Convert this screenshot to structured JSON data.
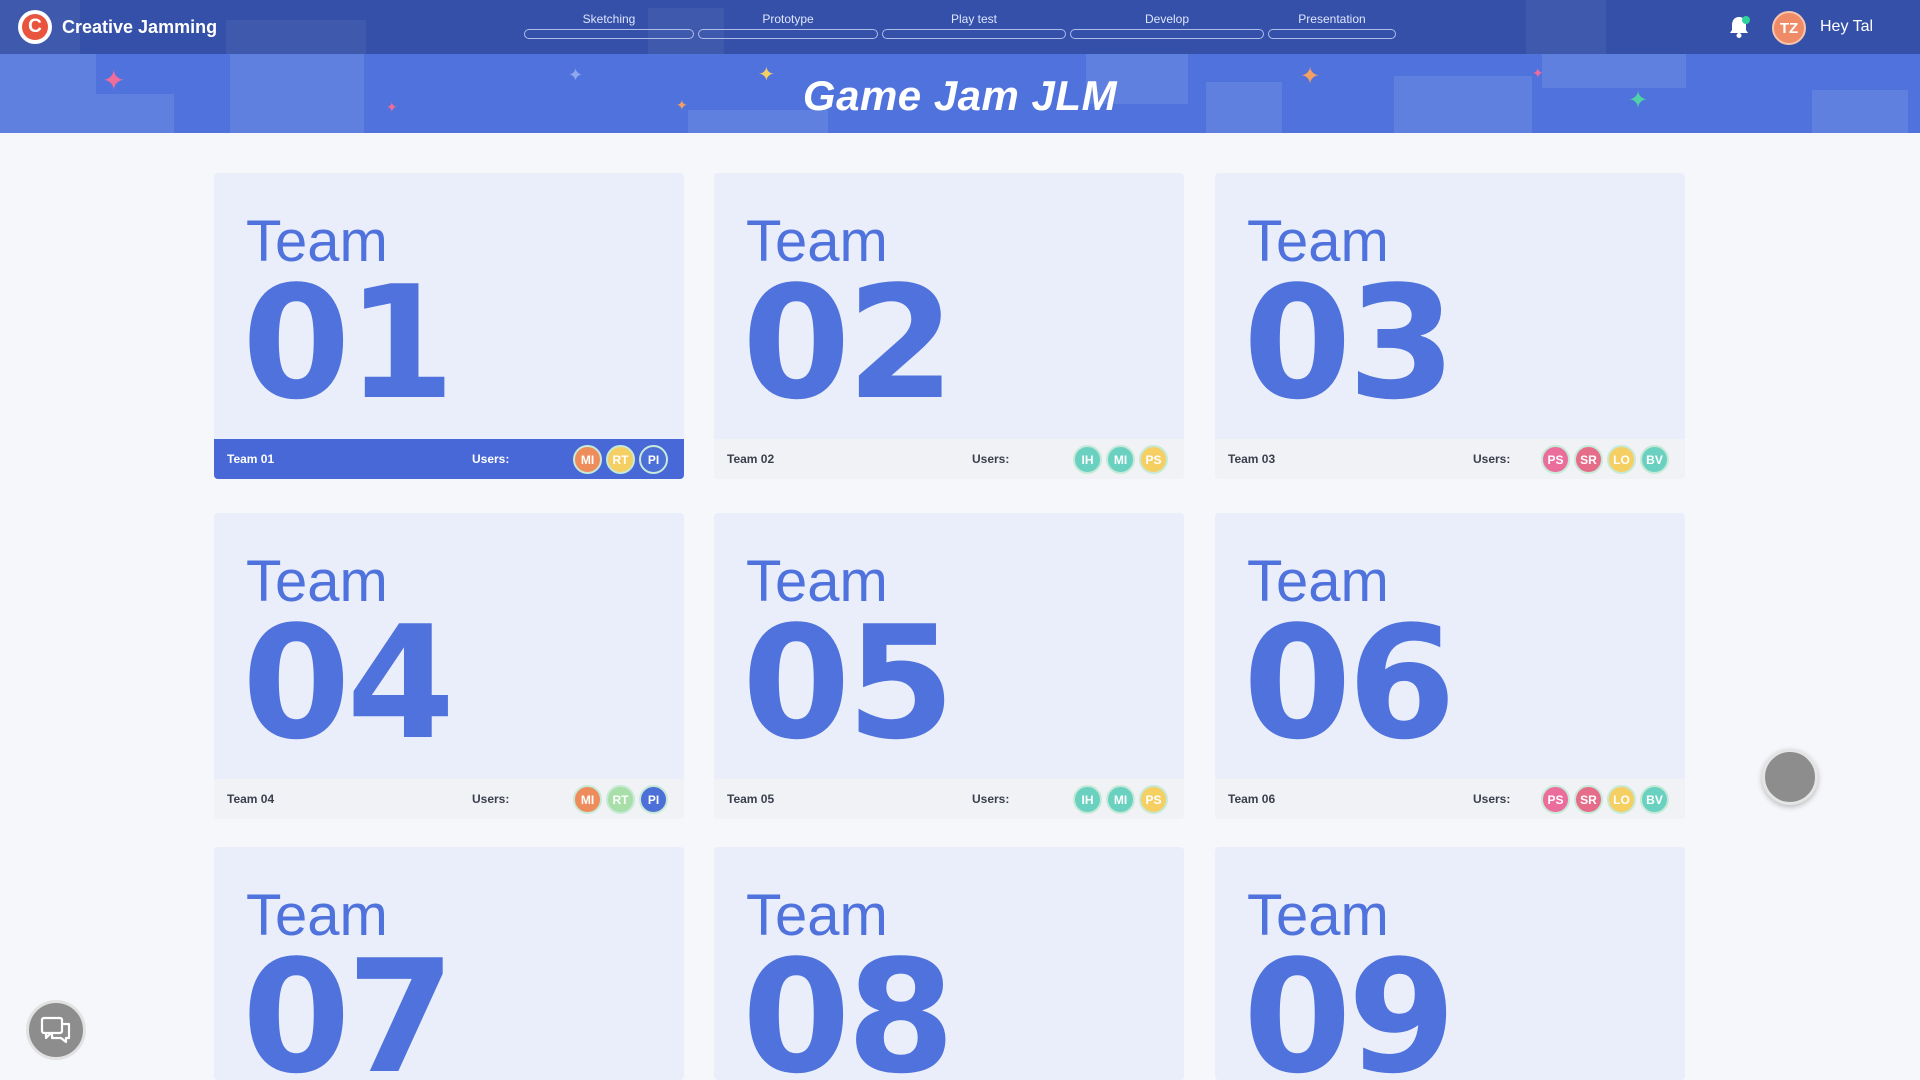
{
  "app": {
    "name": "Creative Jamming",
    "logo_letter": "C"
  },
  "stages": [
    {
      "label": "Sketching"
    },
    {
      "label": "Prototype"
    },
    {
      "label": "Play test"
    },
    {
      "label": "Develop"
    },
    {
      "label": "Presentation"
    }
  ],
  "user": {
    "initials": "TZ",
    "greeting": "Hey Tal"
  },
  "banner": {
    "title": "Game Jam JLM"
  },
  "users_label": "Users:",
  "teams": [
    {
      "word": "Team",
      "number": "01",
      "name": "Team 01",
      "active": true,
      "members": [
        {
          "initials": "MI",
          "color": "#ef8c5b"
        },
        {
          "initials": "RT",
          "color": "#f6cf63"
        },
        {
          "initials": "PI",
          "color": "#4d6fd8"
        }
      ]
    },
    {
      "word": "Team",
      "number": "02",
      "name": "Team 02",
      "active": false,
      "members": [
        {
          "initials": "IH",
          "color": "#6ad1c1"
        },
        {
          "initials": "MI",
          "color": "#6ad1c1"
        },
        {
          "initials": "PS",
          "color": "#f6cf63"
        }
      ]
    },
    {
      "word": "Team",
      "number": "03",
      "name": "Team 03",
      "active": false,
      "members": [
        {
          "initials": "PS",
          "color": "#ea6d9c"
        },
        {
          "initials": "SR",
          "color": "#e66d8a"
        },
        {
          "initials": "LO",
          "color": "#f6cf63"
        },
        {
          "initials": "BV",
          "color": "#6ad1c1"
        }
      ]
    },
    {
      "word": "Team",
      "number": "04",
      "name": "Team 04",
      "active": false,
      "members": [
        {
          "initials": "MI",
          "color": "#ef8c5b"
        },
        {
          "initials": "RT",
          "color": "#a8dfa8"
        },
        {
          "initials": "PI",
          "color": "#4d6fd8"
        }
      ]
    },
    {
      "word": "Team",
      "number": "05",
      "name": "Team 05",
      "active": false,
      "members": [
        {
          "initials": "IH",
          "color": "#6ad1c1"
        },
        {
          "initials": "MI",
          "color": "#6ad1c1"
        },
        {
          "initials": "PS",
          "color": "#f6cf63"
        }
      ]
    },
    {
      "word": "Team",
      "number": "06",
      "name": "Team 06",
      "active": false,
      "members": [
        {
          "initials": "PS",
          "color": "#ea6d9c"
        },
        {
          "initials": "SR",
          "color": "#e66d8a"
        },
        {
          "initials": "LO",
          "color": "#f6cf63"
        },
        {
          "initials": "BV",
          "color": "#6ad1c1"
        }
      ]
    },
    {
      "word": "Team",
      "number": "07"
    },
    {
      "word": "Team",
      "number": "08"
    },
    {
      "word": "Team",
      "number": "09"
    }
  ],
  "icons": {
    "notifications": "bell-icon",
    "chat": "chat-bubbles-icon",
    "fab": "floating-circle-button"
  },
  "colors": {
    "brand_blue": "#4f72dc",
    "nav_blue": "#3450a8",
    "card_bg": "#e9eefa",
    "active_footer": "#4768d6",
    "logo_orange": "#e9543f",
    "notification_dot": "#2dd39b"
  }
}
